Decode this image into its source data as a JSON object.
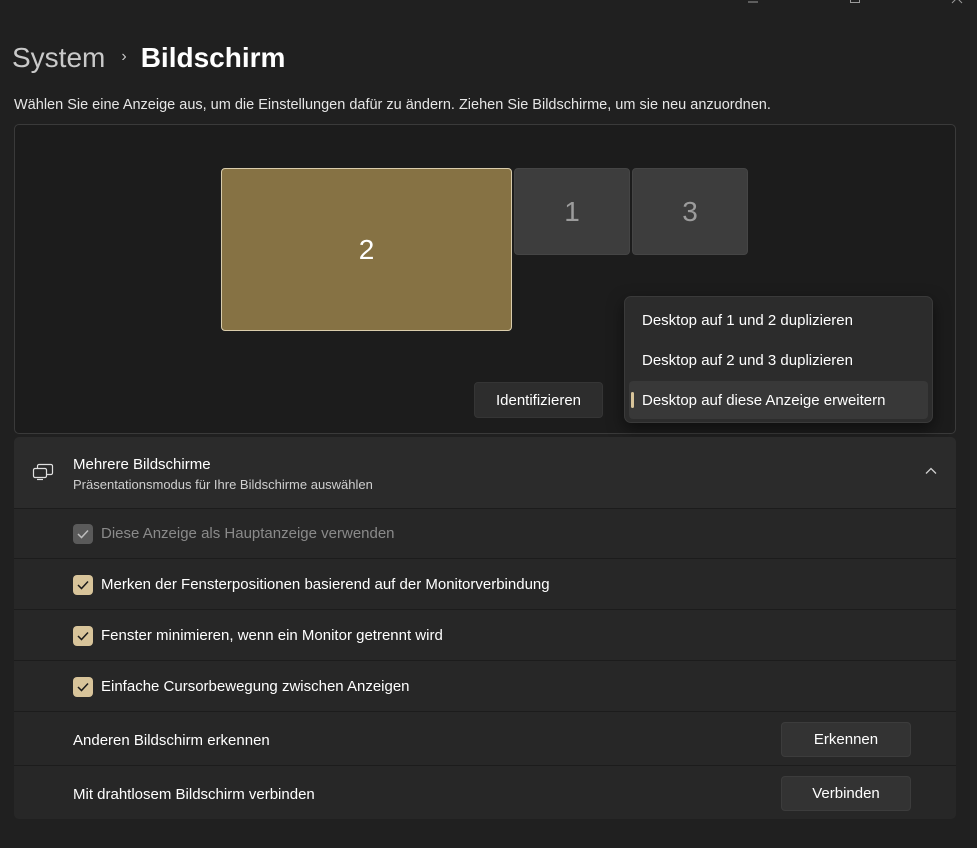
{
  "breadcrumb": {
    "parent": "System",
    "separator": "›",
    "current": "Bildschirm"
  },
  "instruction": "Wählen Sie eine Anzeige aus, um die Einstellungen dafür zu ändern. Ziehen Sie Bildschirme, um sie neu anzuordnen.",
  "monitors": [
    {
      "label": "2",
      "selected": true
    },
    {
      "label": "1",
      "selected": false
    },
    {
      "label": "3",
      "selected": false
    }
  ],
  "identify_button": "Identifizieren",
  "dropdown": {
    "items": [
      {
        "label": "Desktop auf 1 und 2 duplizieren"
      },
      {
        "label": "Desktop auf 2 und 3 duplizieren"
      },
      {
        "label": "Desktop auf diese Anzeige erweitern",
        "selected": true
      }
    ]
  },
  "multiple_displays": {
    "title": "Mehrere Bildschirme",
    "subtitle": "Präsentationsmodus für Ihre Bildschirme auswählen",
    "options": [
      {
        "label": "Diese Anzeige als Hauptanzeige verwenden",
        "checked": true,
        "disabled": true
      },
      {
        "label": "Merken der Fensterpositionen basierend auf der Monitorverbindung",
        "checked": true,
        "disabled": false
      },
      {
        "label": "Fenster minimieren, wenn ein Monitor getrennt wird",
        "checked": true,
        "disabled": false
      },
      {
        "label": "Einfache Cursorbewegung zwischen Anzeigen",
        "checked": true,
        "disabled": false
      }
    ],
    "detect": {
      "label": "Anderen Bildschirm erkennen",
      "button": "Erkennen"
    },
    "wireless": {
      "label": "Mit drahtlosem Bildschirm verbinden",
      "button": "Verbinden"
    }
  },
  "colors": {
    "background": "#202020",
    "accent": "#d8c49a",
    "selected_monitor": "#867244",
    "card": "#272727"
  },
  "icons": [
    "minimize-icon",
    "maximize-icon",
    "close-icon",
    "chevron-right-icon",
    "multiple-displays-icon",
    "chevron-up-icon",
    "checkmark-icon"
  ]
}
